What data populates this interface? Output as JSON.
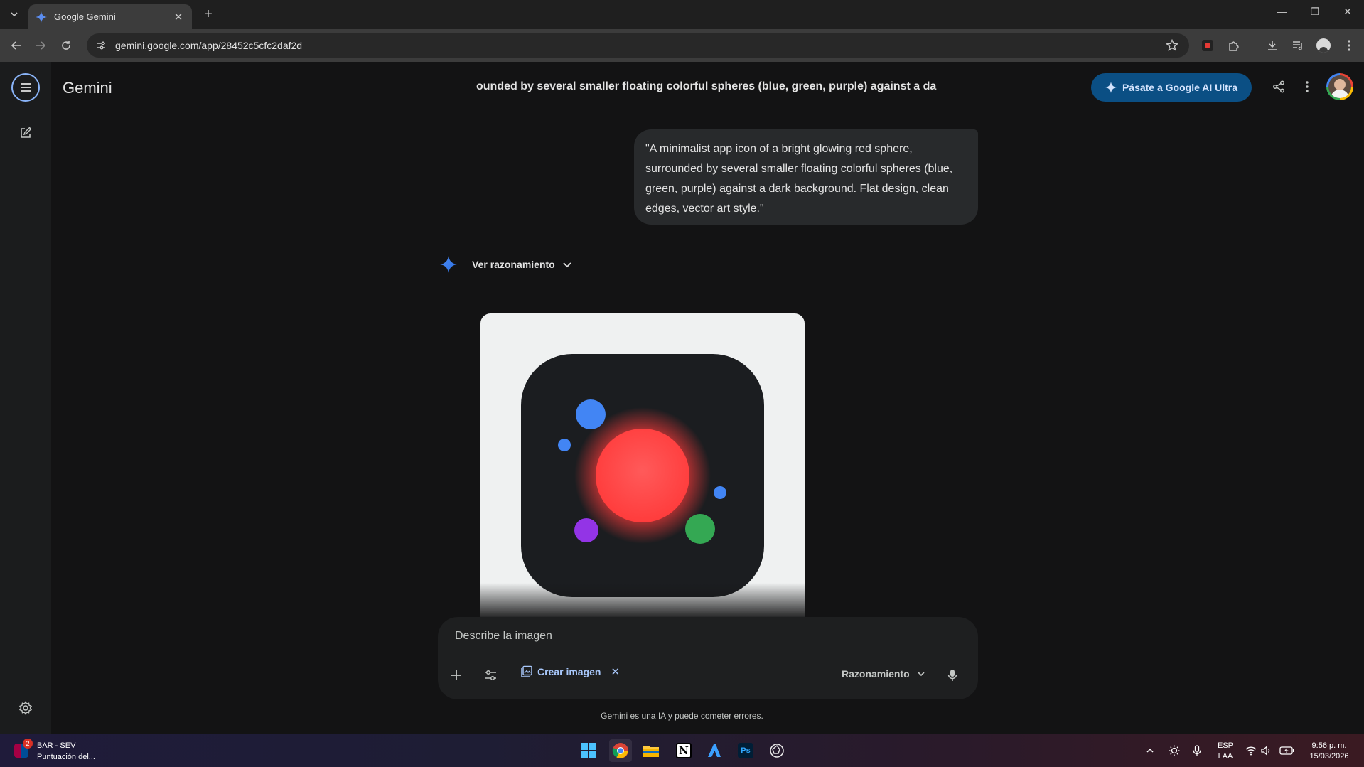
{
  "browser": {
    "tab_title": "Google Gemini",
    "url": "gemini.google.com/app/28452c5cfc2daf2d"
  },
  "header": {
    "brand": "Gemini",
    "conversation_title": "ounded by several smaller floating colorful spheres (blue, green, purple) against a da",
    "upgrade_label": "Pásate a Google AI Ultra"
  },
  "chat": {
    "user_prompt": "\"A minimalist app icon of a bright glowing red sphere, surrounded by several smaller floating colorful spheres (blue, green, purple) against a dark background. Flat design, clean edges, vector art style.\"",
    "reasoning_label": "Ver razonamiento"
  },
  "composer": {
    "placeholder": "Describe la imagen",
    "tool_chip": "Crear imagen",
    "mode": "Razonamiento"
  },
  "disclaimer": "Gemini es una IA y puede cometer errores.",
  "taskbar": {
    "weather_title": "BAR - SEV",
    "weather_sub": "Puntuación del...",
    "weather_badge": "2",
    "lang_1": "ESP",
    "lang_2": "LAA",
    "time": "9:56 p. m.",
    "date": "15/03/2026"
  },
  "colors": {
    "accent": "#8ab4f8",
    "upgrade_bg": "#0b4f84",
    "red_sphere": "#ff4848",
    "blue_sphere": "#4285f4",
    "green_sphere": "#34a853",
    "purple_sphere": "#9334e6"
  }
}
